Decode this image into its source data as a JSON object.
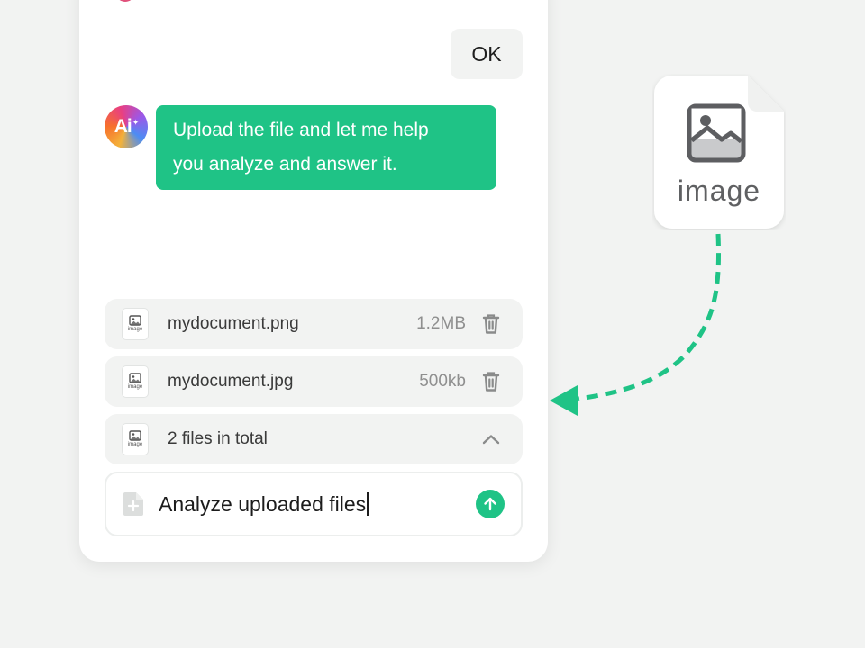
{
  "chat": {
    "user_message": "OK",
    "ai_avatar_label": "Ai",
    "ai_message_line1": "Upload the file and let me help",
    "ai_message_line2": "you analyze and answer it.",
    "accent_color": "#1fc386"
  },
  "files": [
    {
      "name": "mydocument.png",
      "size": "1.2MB",
      "icon": "image-file-icon",
      "icon_label": "image",
      "action": "trash-icon"
    },
    {
      "name": "mydocument.jpg",
      "size": "500kb",
      "icon": "image-file-icon",
      "icon_label": "image",
      "action": "trash-icon"
    }
  ],
  "summary": {
    "text": "2 files in total",
    "icon_label": "image",
    "action": "chevron-up-icon"
  },
  "composer": {
    "value": "Analyze uploaded files",
    "attach_icon": "add-file-icon",
    "send_icon": "arrow-up-icon"
  },
  "drag_card": {
    "label": "image",
    "icon": "image-icon"
  }
}
